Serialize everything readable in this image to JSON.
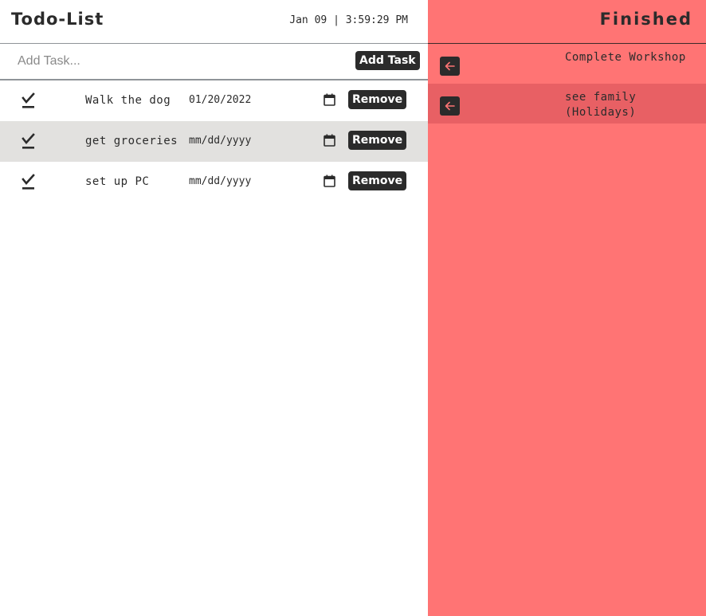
{
  "header": {
    "title": "Todo-List",
    "clock": "Jan 09 | 3:59:29 PM"
  },
  "add_task": {
    "placeholder": "Add Task...",
    "button_label": "Add Task"
  },
  "tasks": [
    {
      "text": "Walk the dog",
      "date": "01/20/2022",
      "remove_label": "Remove",
      "check_icon": "check-icon",
      "calendar_icon": "calendar-icon"
    },
    {
      "text": "get groceries",
      "date": "mm/dd/yyyy",
      "remove_label": "Remove",
      "check_icon": "check-icon",
      "calendar_icon": "calendar-icon"
    },
    {
      "text": "set up PC",
      "date": "mm/dd/yyyy",
      "remove_label": "Remove",
      "check_icon": "check-icon",
      "calendar_icon": "calendar-icon"
    }
  ],
  "finished": {
    "title": "Finished",
    "items": [
      {
        "text": "Complete Workshop",
        "undo_icon": "arrow-left-icon"
      },
      {
        "text": "see family (Holidays)",
        "undo_icon": "arrow-left-icon"
      }
    ]
  },
  "colors": {
    "dark": "#2b2b2b",
    "finished_panel": "#ff7474",
    "finished_row_alt": "#e86064",
    "task_row_alt": "#e2e1df",
    "undo_arrow": "#ff7474"
  }
}
